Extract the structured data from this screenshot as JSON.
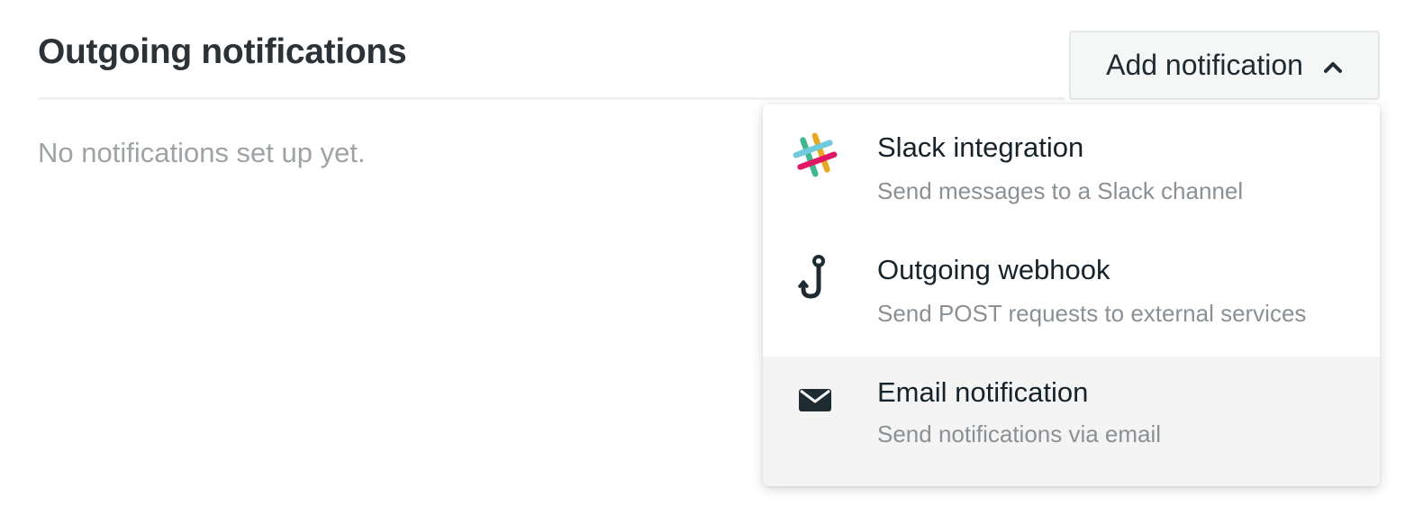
{
  "header": {
    "title": "Outgoing notifications",
    "add_button_label": "Add notification",
    "add_button_icon": "chevron-up-icon"
  },
  "main": {
    "empty_text": "No notifications set up yet."
  },
  "menu": {
    "items": [
      {
        "title": "Slack integration",
        "description": "Send messages to a Slack channel",
        "icon": "slack-icon"
      },
      {
        "title": "Outgoing webhook",
        "description": "Send POST requests to external services",
        "icon": "webhook-hook-icon"
      },
      {
        "title": "Email notification",
        "description": "Send notifications via email",
        "icon": "envelope-icon",
        "highlighted": true
      }
    ]
  },
  "colors": {
    "text_primary": "#1f2b33",
    "text_muted": "#9ea3a6",
    "menu_highlight": "#f4f4f4",
    "slack_green": "#3eb890",
    "slack_teal": "#70cadb",
    "slack_red": "#e01765",
    "slack_yellow": "#e8a723"
  }
}
